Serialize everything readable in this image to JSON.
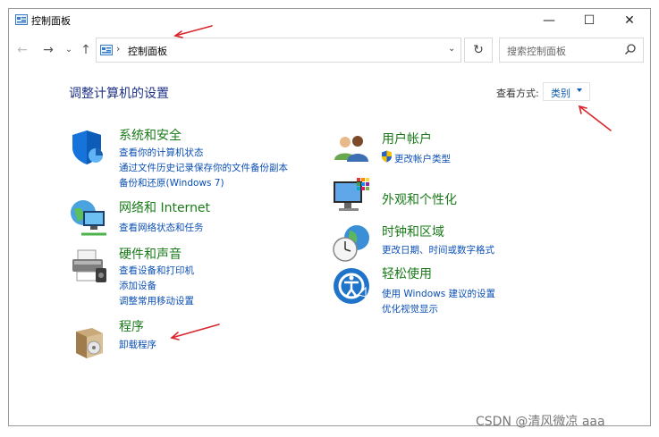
{
  "window": {
    "title": "控制面板",
    "controls": {
      "minimize": "—",
      "maximize": "☐",
      "close": "✕"
    }
  },
  "address_bar": {
    "back": "←",
    "forward": "→",
    "recent": "⌄",
    "up": "↑",
    "separator": "›",
    "path": "控制面板",
    "dropdown": "⌄",
    "refresh": "↻"
  },
  "search": {
    "placeholder": "搜索控制面板",
    "icon": "search-icon"
  },
  "main": {
    "heading": "调整计算机的设置",
    "view_by_label": "查看方式:",
    "view_by_value": "类别"
  },
  "categories_left": [
    {
      "title": "系统和安全",
      "icon": "shield-icon",
      "links": [
        "查看你的计算机状态",
        "通过文件历史记录保存你的文件备份副本",
        "备份和还原(Windows 7)"
      ]
    },
    {
      "title": "网络和 Internet",
      "icon": "network-globe-icon",
      "links": [
        "查看网络状态和任务"
      ]
    },
    {
      "title": "硬件和声音",
      "icon": "printer-icon",
      "links": [
        "查看设备和打印机",
        "添加设备",
        "调整常用移动设置"
      ]
    },
    {
      "title": "程序",
      "icon": "program-box-icon",
      "links": [
        "卸载程序"
      ]
    }
  ],
  "categories_right": [
    {
      "title": "用户帐户",
      "icon": "users-icon",
      "links": [
        "更改帐户类型"
      ]
    },
    {
      "title": "外观和个性化",
      "icon": "monitor-icon",
      "links": []
    },
    {
      "title": "时钟和区域",
      "icon": "clock-globe-icon",
      "links": [
        "更改日期、时间或数字格式"
      ]
    },
    {
      "title": "轻松使用",
      "icon": "ease-of-access-icon",
      "links": [
        "使用 Windows 建议的设置",
        "优化视觉显示"
      ]
    }
  ],
  "watermark": "CSDN @清风微凉 aaa",
  "colors": {
    "heading": "#1e3287",
    "category_title": "#1a7a1a",
    "link": "#0b4fb4",
    "annotation_arrow": "#d8262c"
  }
}
